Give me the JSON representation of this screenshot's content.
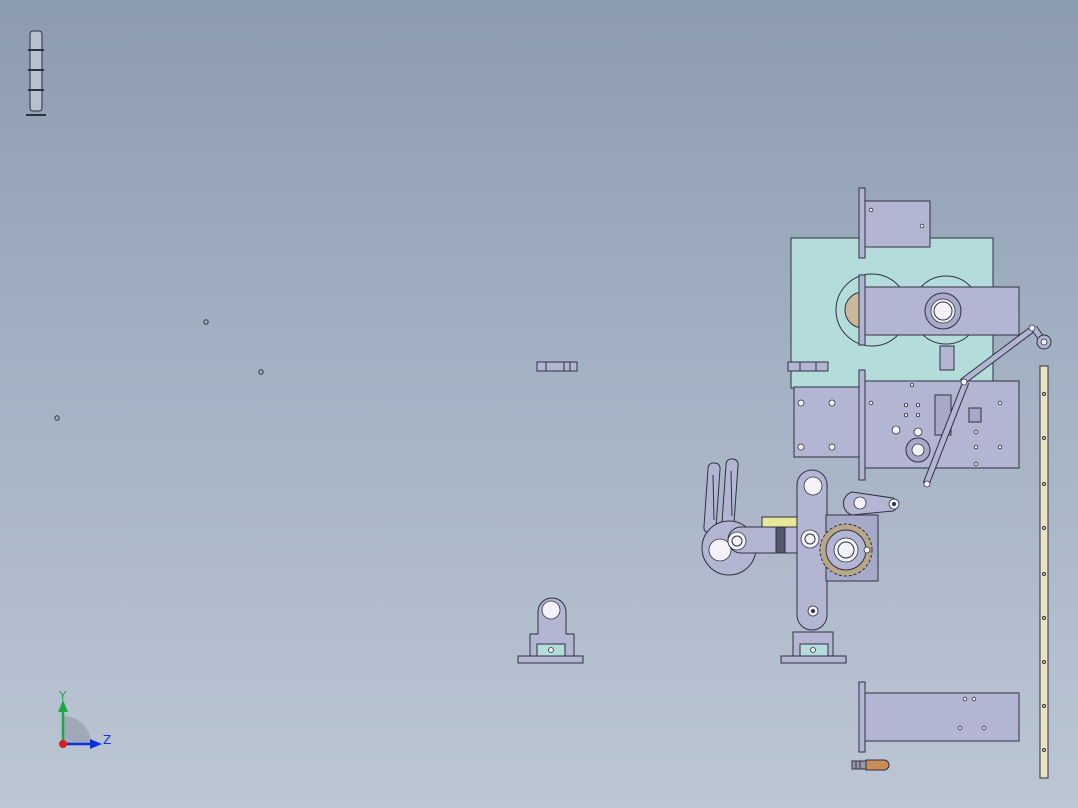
{
  "viewport": {
    "background_top": "#8c9bb0",
    "background_bottom": "#bcc6d4",
    "part_color": "#b3b6d2",
    "housing_color": "#b4dcdb",
    "accent_yellow": "#e8e89a",
    "rail_color": "#e9e3bf",
    "line_color": "#2f3140"
  },
  "triad": {
    "y_label": "Y",
    "z_label": "Z",
    "y_color": "#1aa84a",
    "z_color": "#1030d8",
    "origin_color": "#d81e1e"
  },
  "icons": {
    "stacked_tower": "signal-tower-icon",
    "triad": "axis-triad-icon"
  }
}
